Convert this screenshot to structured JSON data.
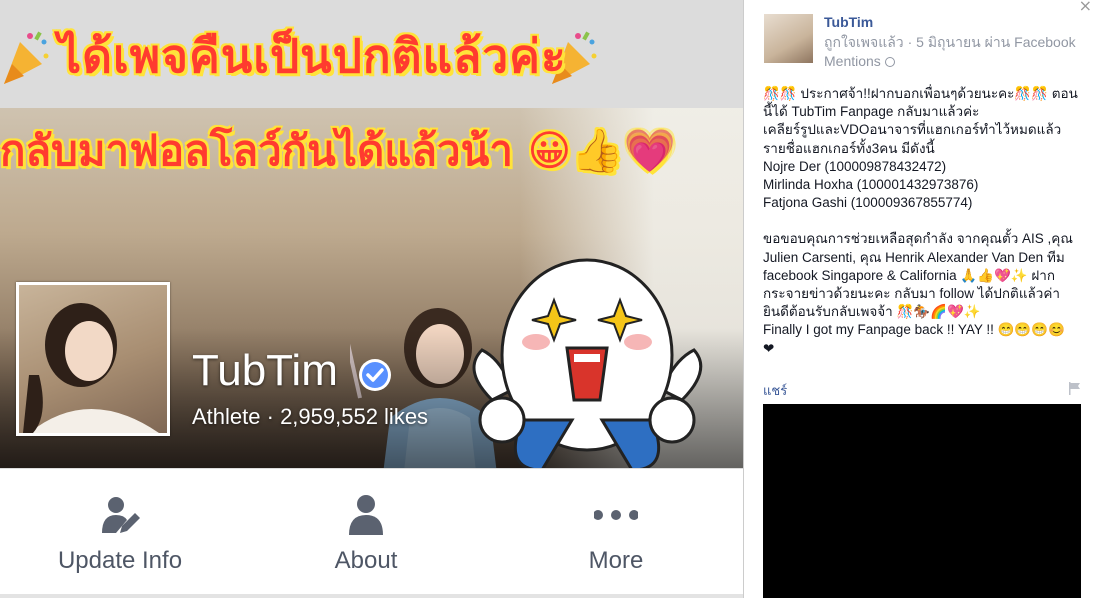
{
  "cover": {
    "banner_line1": "ได้เพจคืนเป็นปกติแล้วค่ะ",
    "banner_line2": "กลับมาฟอลโลว์กันได้แล้วน้า",
    "banner_emoji": "😀👍💗"
  },
  "page": {
    "name": "TubTim",
    "category": "Athlete",
    "likes": "2,959,552 likes",
    "meta_separator": " · "
  },
  "actions": [
    {
      "label": "Update Info",
      "icon": "edit-user-icon"
    },
    {
      "label": "About",
      "icon": "person-icon"
    },
    {
      "label": "More",
      "icon": "more-dots-icon"
    }
  ],
  "post": {
    "author": "TubTim",
    "meta_action": "ถูกใจเพจแล้ว",
    "meta_dot": " · ",
    "meta_date": "5 มิถุนายน ผ่าน Facebook Mentions",
    "lines": [
      "🎊🎊 ประกาศจ้า!!ฝากบอกเพื่อนๆด้วยนะคะ🎊🎊 ตอนนี้ได้ TubTim Fanpage กลับมาแล้วค่ะ",
      "เคลียร์รูปและVDOอนาจารที่แฮกเกอร์ทำไว้หมดแล้ว",
      "รายชื่อแฮกเกอร์ทั้ง3คน มีดังนี้",
      "Nojre Der (100009878432472)",
      "Mirlinda Hoxha (100001432973876)",
      "Fatjona Gashi (100009367855774)"
    ],
    "lines2": [
      "ขอขอบคุณการช่วยเหลือสุดกำลัง จากคุณตั้ว AIS ,คุณ Julien Carsenti, คุณ Henrik Alexander Van Den ทีม facebook Singapore & California 🙏👍💖✨ ฝากกระจายข่าวด้วยนะคะ กลับมา follow ได้ปกติแล้วค่า ยินดีต้อนรับกลับเพจจ้า 🎊🏇🌈💖✨",
      "Finally I got my Fanpage back !! YAY !! 😁😁😁😊",
      "❤"
    ],
    "share_label": "แชร์"
  },
  "colors": {
    "link_blue": "#3b5998",
    "banner_red": "#ff3b2f",
    "banner_yellow": "#ffe33a",
    "verified_blue": "#5890ff",
    "action_gray": "#4e5665"
  }
}
